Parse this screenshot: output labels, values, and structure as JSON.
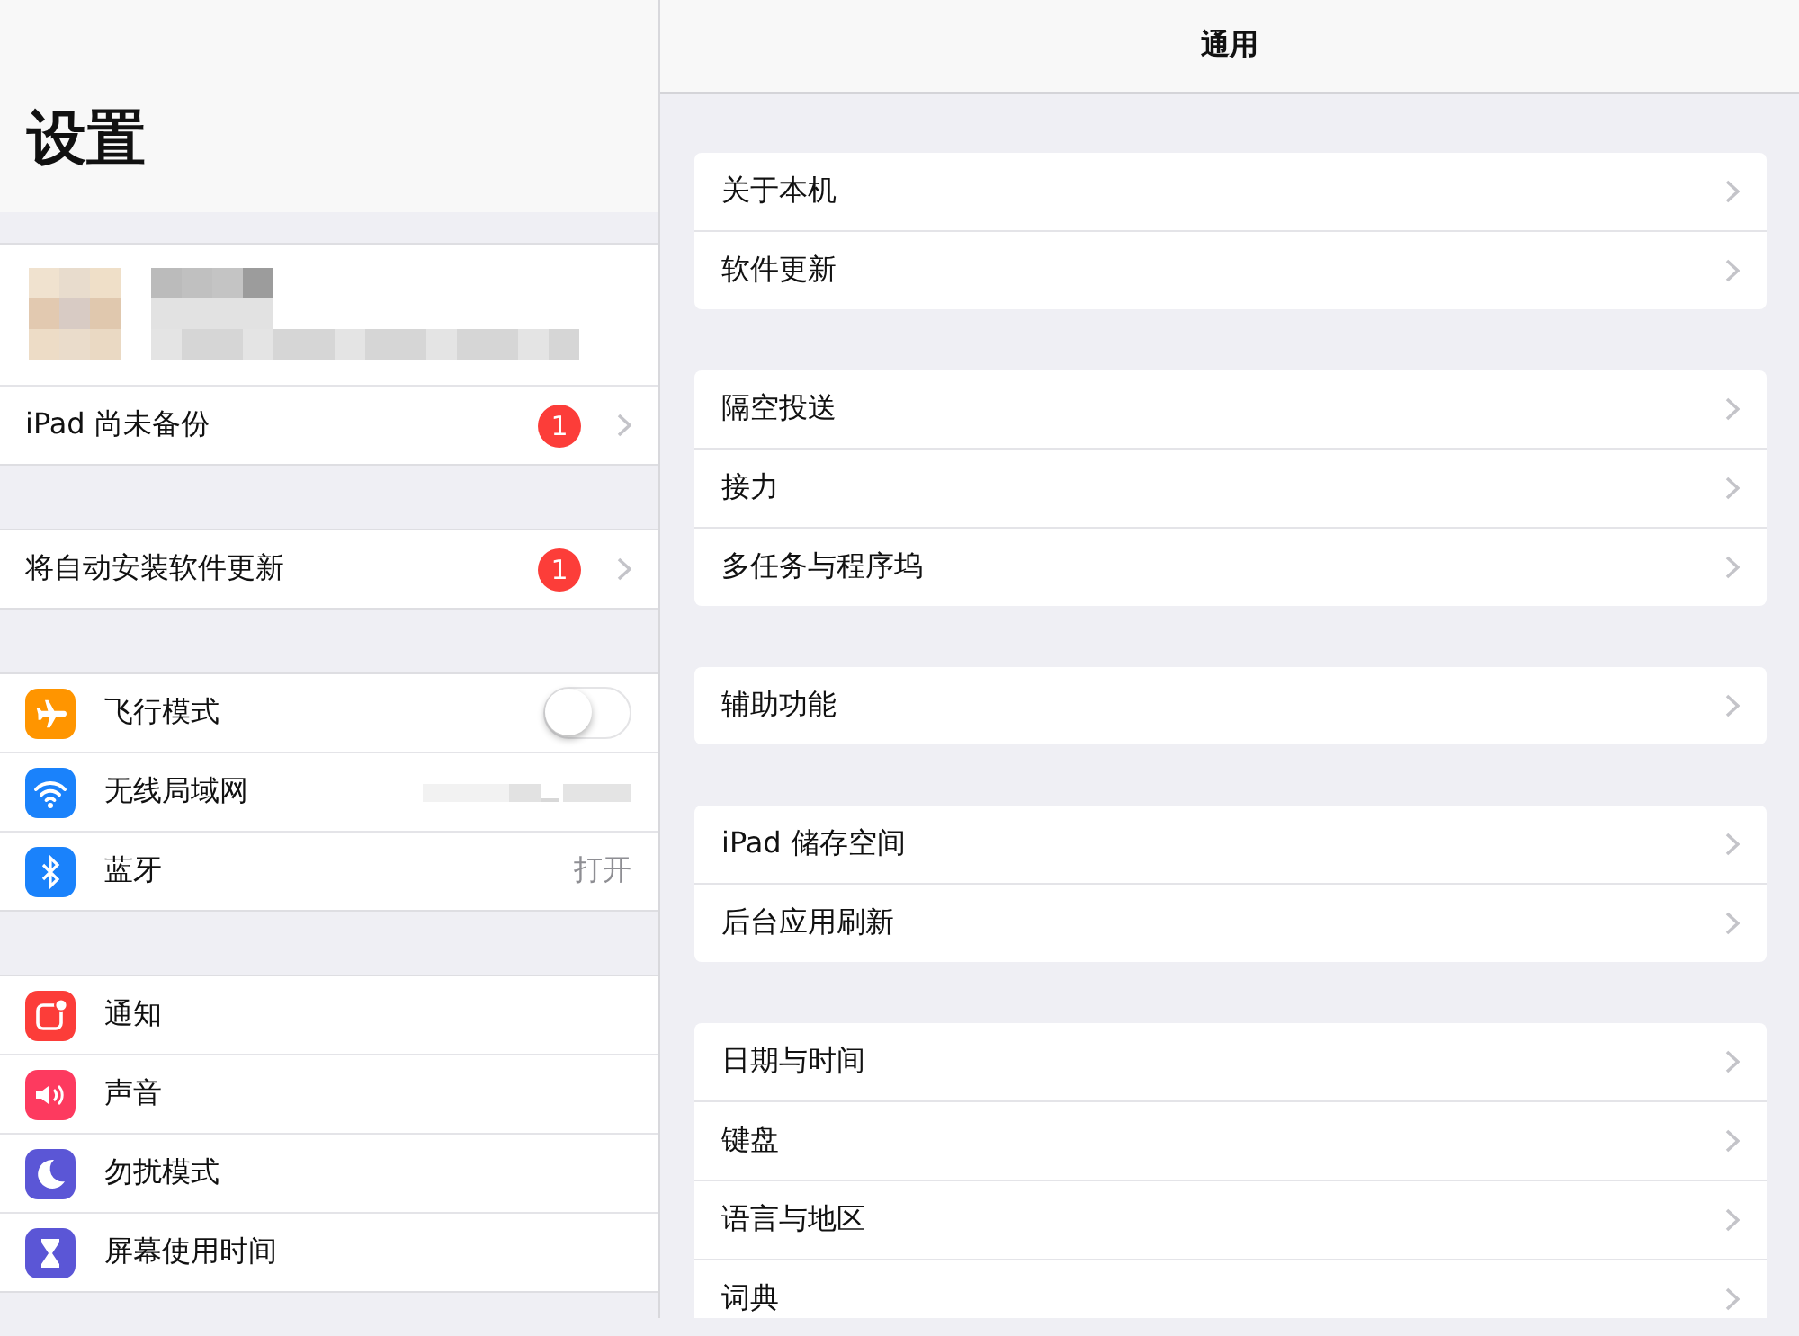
{
  "sidebar": {
    "title": "设置",
    "groups": [
      {
        "rows": [
          {
            "kind": "profile"
          },
          {
            "kind": "link",
            "label": "iPad 尚未备份",
            "badge": "1"
          }
        ]
      },
      {
        "rows": [
          {
            "kind": "link",
            "label": "将自动安装软件更新",
            "badge": "1"
          }
        ]
      },
      {
        "rows": [
          {
            "kind": "toggle",
            "label": "飞行模式",
            "color": "#ff9500",
            "on": false
          },
          {
            "kind": "value",
            "label": "无线局域网",
            "color": "#1a82fb",
            "redacted": true
          },
          {
            "kind": "value",
            "label": "蓝牙",
            "color": "#1a82fb",
            "value": "打开"
          }
        ]
      },
      {
        "rows": [
          {
            "kind": "link",
            "label": "通知",
            "color": "#fc3d39"
          },
          {
            "kind": "link",
            "label": "声音",
            "color": "#fd3a5f"
          },
          {
            "kind": "link",
            "label": "勿扰模式",
            "color": "#5b56d6"
          },
          {
            "kind": "link",
            "label": "屏幕使用时间",
            "color": "#5b56d6"
          }
        ]
      }
    ]
  },
  "detail": {
    "title": "通用",
    "groups": [
      [
        "关于本机",
        "软件更新"
      ],
      [
        "隔空投送",
        "接力",
        "多任务与程序坞"
      ],
      [
        "辅助功能"
      ],
      [
        "iPad 储存空间",
        "后台应用刷新"
      ],
      [
        "日期与时间",
        "键盘",
        "语言与地区",
        "词典"
      ]
    ]
  }
}
